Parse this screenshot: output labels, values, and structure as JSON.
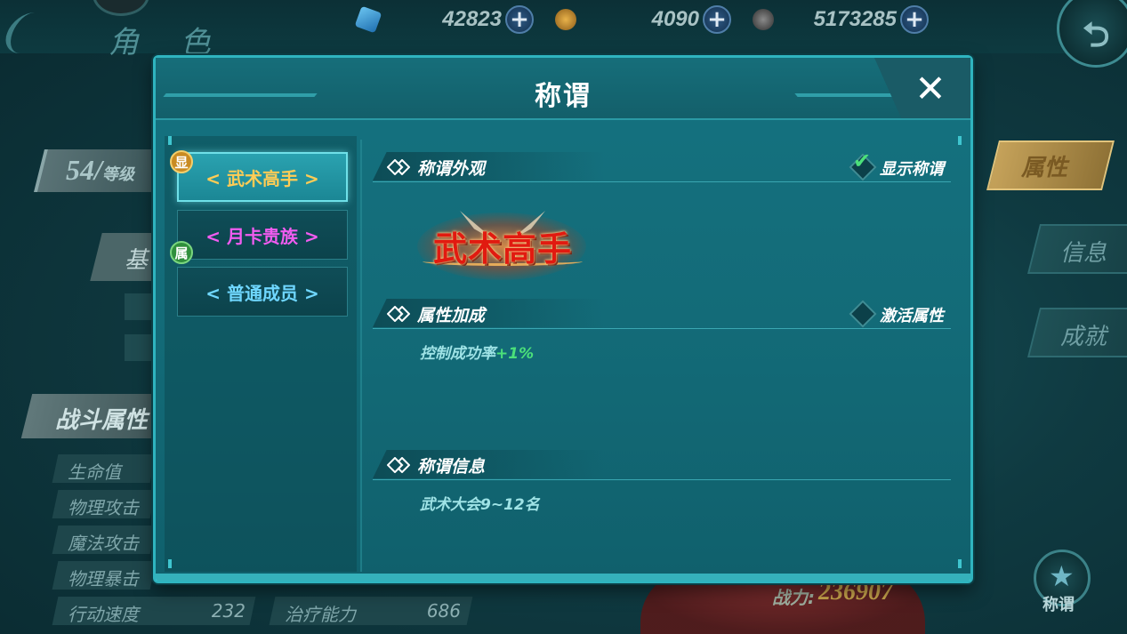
{
  "screen": {
    "title": "角 色",
    "currencies": [
      {
        "icon": "blue-crystal-icon",
        "value": "42823",
        "color": "#3a8fd0"
      },
      {
        "icon": "gold-coin-icon",
        "value": "4090",
        "color": "#c08a2a"
      },
      {
        "icon": "silver-coin-icon",
        "value": "5173285",
        "color": "#6a6a6a"
      }
    ],
    "level": {
      "number": "54/",
      "unit": "等级"
    },
    "basic_tab": "基",
    "battle_header": "战斗属性",
    "stats": [
      {
        "label": "生命值"
      },
      {
        "label": "物理攻击"
      },
      {
        "label": "魔法攻击"
      },
      {
        "label": "物理暴击"
      },
      {
        "label": "行动速度",
        "value": "232"
      }
    ],
    "stats_right": [
      {
        "label": "治疗能力",
        "value": "686"
      }
    ],
    "side_tabs": [
      {
        "label": "属性",
        "active": true
      },
      {
        "label": "信息",
        "active": false
      },
      {
        "label": "成就",
        "active": false
      }
    ],
    "power": {
      "label": "战力:",
      "value": "236907"
    },
    "title_button_label": "称谓"
  },
  "dialog": {
    "title": "称谓",
    "close_icon": "close-icon",
    "tags": {
      "shown": "显",
      "attribute": "属"
    },
    "titles": [
      {
        "label": "< 武术高手 >",
        "color": "#ffcc55",
        "selected": true
      },
      {
        "label": "< 月卡贵族 >",
        "color": "#f15cf0",
        "selected": false
      },
      {
        "label": "< 普通成员 >",
        "color": "#6fd7ff",
        "selected": false
      }
    ],
    "appearance": {
      "header": "称谓外观",
      "toggle_label": "显示称谓",
      "toggle_checked": true,
      "emblem_text": "武术高手"
    },
    "attributes": {
      "header": "属性加成",
      "toggle_label": "激活属性",
      "toggle_checked": false,
      "bonus_name": "控制成功率",
      "bonus_value": "+1%"
    },
    "info": {
      "header": "称谓信息",
      "text": "武术大会9~12名"
    }
  }
}
